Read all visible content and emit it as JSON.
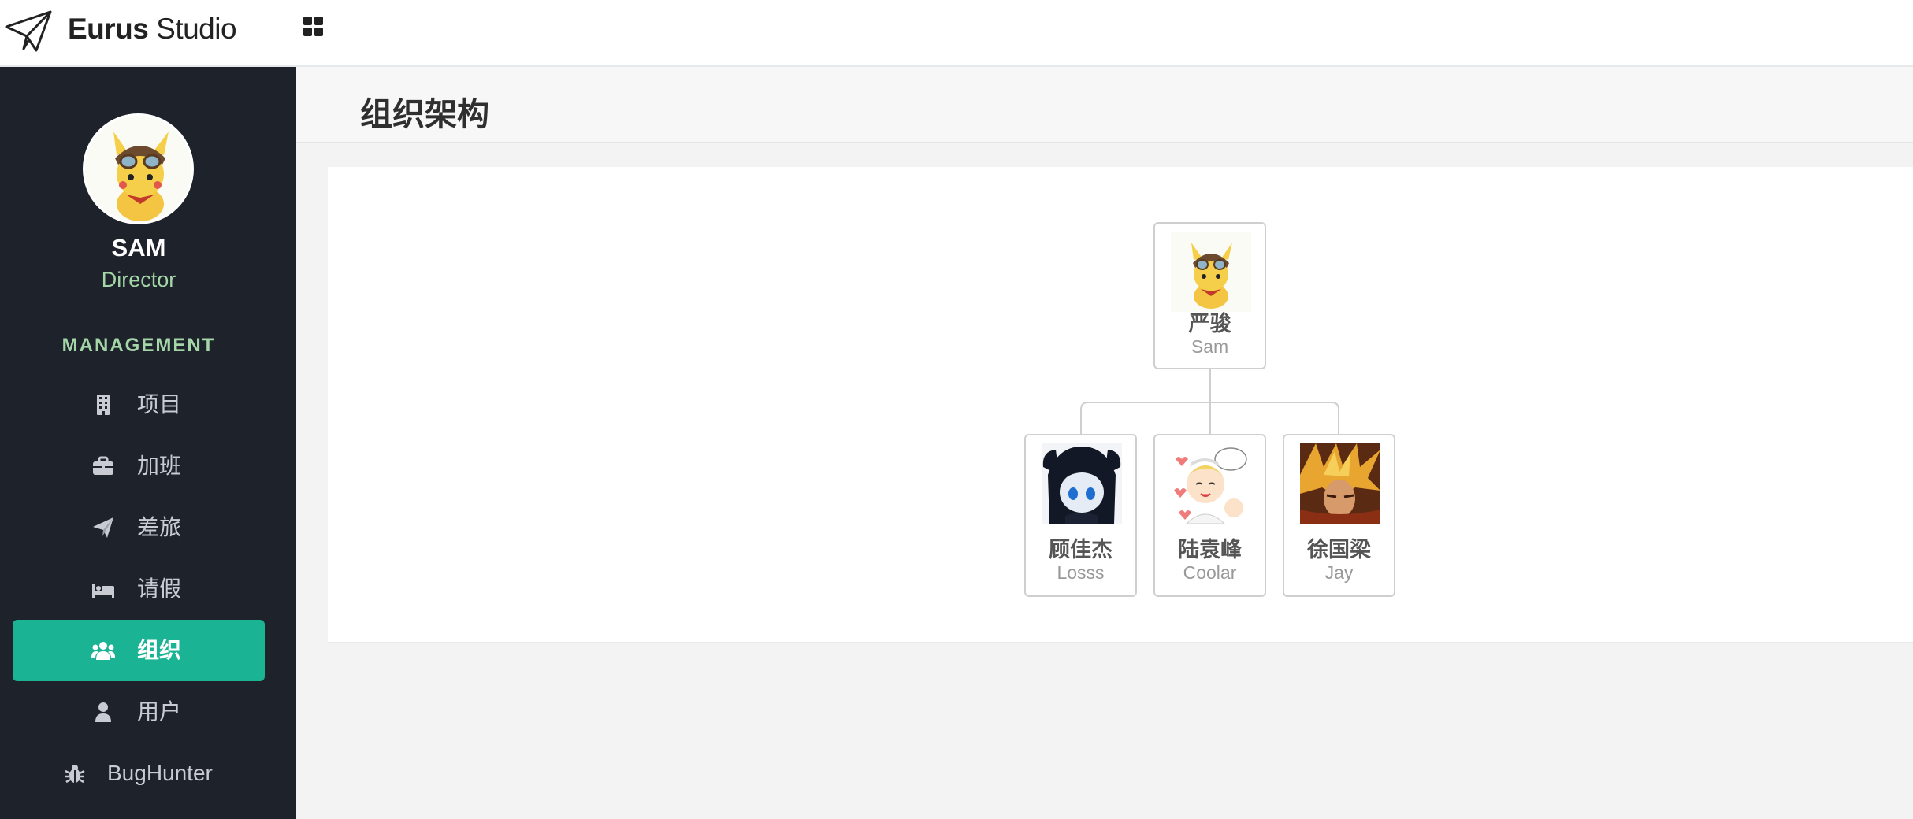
{
  "brand": {
    "bold": "Eurus",
    "light": " Studio"
  },
  "profile": {
    "name": "SAM",
    "role": "Director"
  },
  "sidebar": {
    "section": "MANAGEMENT",
    "items": [
      {
        "label": "项目",
        "icon": "building-icon"
      },
      {
        "label": "加班",
        "icon": "briefcase-icon"
      },
      {
        "label": "差旅",
        "icon": "paper-plane-icon"
      },
      {
        "label": "请假",
        "icon": "bed-icon"
      },
      {
        "label": "组织",
        "icon": "users-icon",
        "active": true
      },
      {
        "label": "用户",
        "icon": "user-icon"
      },
      {
        "label": "BugHunter",
        "icon": "bug-icon"
      }
    ]
  },
  "page": {
    "title": "组织架构"
  },
  "org": {
    "root": {
      "cn": "严骏",
      "en": "Sam"
    },
    "children": [
      {
        "cn": "顾佳杰",
        "en": "Losss"
      },
      {
        "cn": "陆袁峰",
        "en": "Coolar"
      },
      {
        "cn": "徐国梁",
        "en": "Jay"
      }
    ]
  },
  "colors": {
    "sidebar_bg": "#1e222b",
    "accent": "#1ab394",
    "role_text": "#a5d6a7"
  }
}
